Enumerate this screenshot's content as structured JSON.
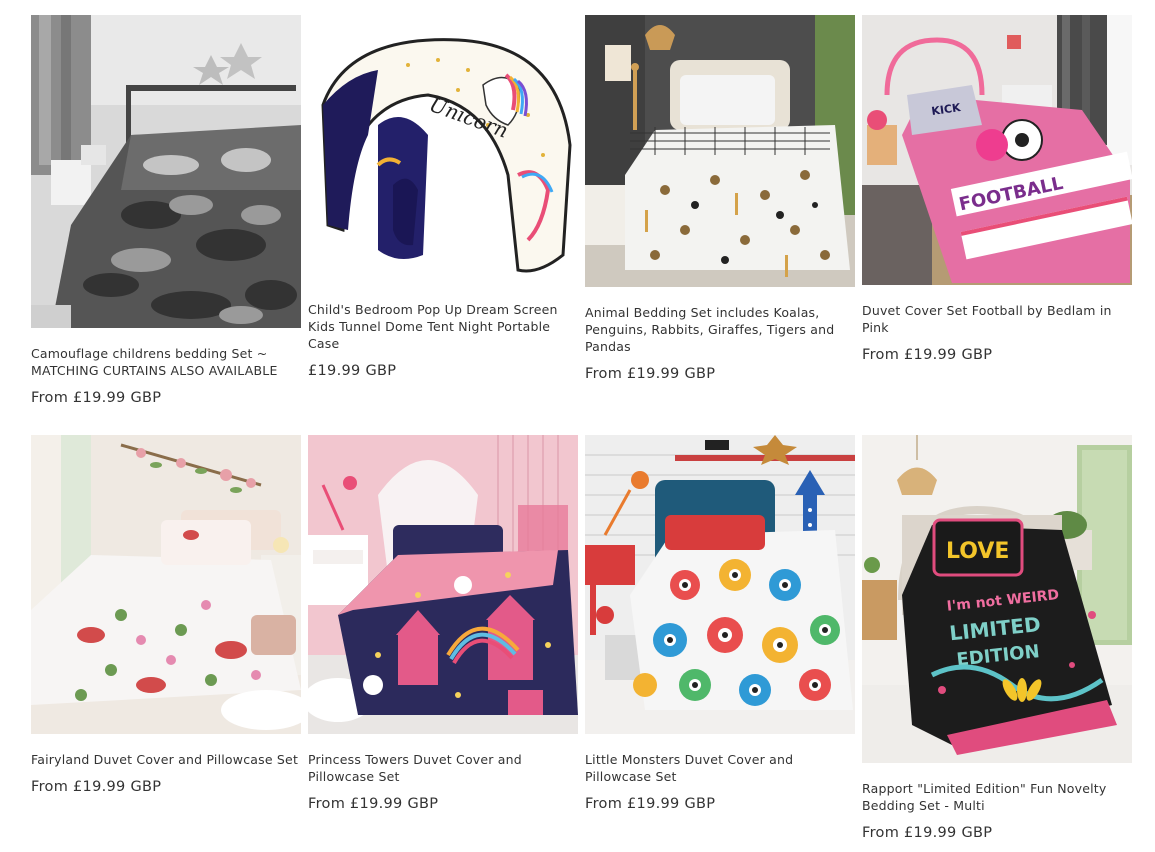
{
  "products": [
    {
      "title": "Camouflage childrens bedding Set ~ MATCHING CURTAINS ALSO AVAILABLE",
      "price": "From £19.99 GBP",
      "image": "grey-camouflage-bedding-photo"
    },
    {
      "title": "Child's Bedroom Pop Up Dream Screen Kids Tunnel Dome Tent Night Portable Case",
      "price": "£19.99 GBP",
      "image": "unicorn-bed-tent-photo"
    },
    {
      "title": "Animal Bedding Set includes Koalas, Penguins, Rabbits, Giraffes, Tigers and Pandas",
      "price": "From £19.99 GBP",
      "image": "animal-print-bedding-photo"
    },
    {
      "title": "Duvet Cover Set Football by Bedlam in Pink",
      "price": "From £19.99 GBP",
      "image": "pink-football-bedding-photo"
    },
    {
      "title": "Fairyland Duvet Cover and Pillowcase Set",
      "price": "From £19.99 GBP",
      "image": "fairyland-bedding-photo"
    },
    {
      "title": "Princess Towers Duvet Cover and Pillowcase Set",
      "price": "From £19.99 GBP",
      "image": "princess-towers-bedding-photo"
    },
    {
      "title": "Little Monsters Duvet Cover and Pillowcase Set",
      "price": "From £19.99 GBP",
      "image": "little-monsters-bedding-photo"
    },
    {
      "title": "Rapport \"Limited Edition\" Fun Novelty Bedding Set - Multi",
      "price": "From £19.99 GBP",
      "image": "limited-edition-bedding-photo"
    }
  ],
  "image_texts": {
    "tent_script": "Unicorn",
    "love": "LOVE",
    "not_weird": "I'm not WEIRD",
    "limited": "LIMITED",
    "edition": "EDITION",
    "football": "FOOTBALL"
  }
}
